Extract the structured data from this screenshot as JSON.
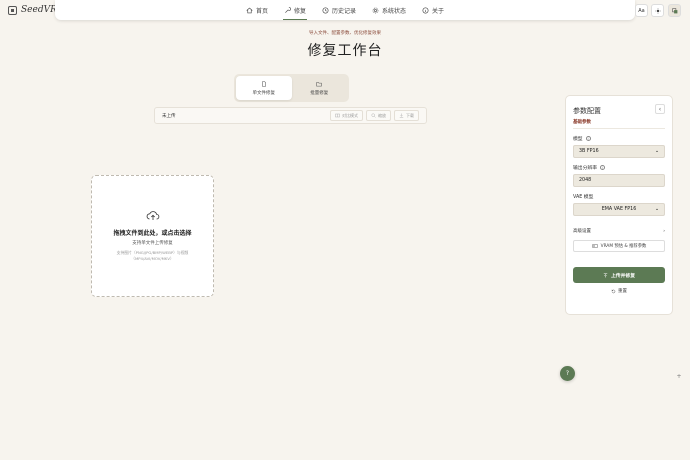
{
  "app": {
    "name": "SeedVR2"
  },
  "nav": {
    "items": [
      {
        "label": "首页",
        "icon": "home-icon"
      },
      {
        "label": "修复",
        "icon": "wrench-icon",
        "active": true
      },
      {
        "label": "历史记录",
        "icon": "history-icon"
      },
      {
        "label": "系统状态",
        "icon": "gear-icon"
      },
      {
        "label": "关于",
        "icon": "info-icon"
      }
    ]
  },
  "topbar": {
    "font_btn": "Aa",
    "theme_icon": "sun-icon",
    "extra_icon": "copy-icon"
  },
  "hero": {
    "subtitle": "导入文件、配置参数、优化修复效果",
    "title": "修复工作台"
  },
  "modes": [
    {
      "label": "单文件修复",
      "icon": "file-icon",
      "active": true
    },
    {
      "label": "批量修复",
      "icon": "folder-icon",
      "active": false
    }
  ],
  "toolbar": {
    "status": "未上传",
    "compare_label": "对比模式",
    "zoom_label": "缩放",
    "download_label": "下载"
  },
  "dropzone": {
    "title": "拖拽文件到此处，或点击选择",
    "sub": "支持单文件上传修复",
    "hint_line1": "支持图片（PNG/JPG/BMP/WEBP）与视频",
    "hint_line2": "（MP4/AVI/MOV/MKV）"
  },
  "panel": {
    "title": "参数配置",
    "section": "基础参数",
    "model_label": "模型",
    "model_value": "3B FP16",
    "resolution_label": "输出分辨率",
    "resolution_value": "2048",
    "vae_label": "VAE 模型",
    "vae_value": "EMA VAE FP16",
    "advanced_label": "高级设置",
    "vram_label": "VRAM 预估 & 推荐参数",
    "upload_label": "上传并修复",
    "reset_label": "重置"
  },
  "fab": {
    "label": "?"
  },
  "colors": {
    "accent": "#5c7a54",
    "background": "#f7f4ee",
    "section_tag": "#8a3a2a"
  }
}
